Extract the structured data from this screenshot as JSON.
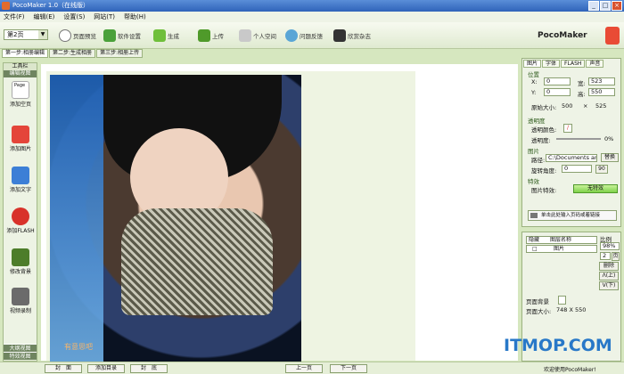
{
  "window": {
    "title": "PocoMaker 1.0（在线版）"
  },
  "menu": [
    "文件(F)",
    "编辑(E)",
    "设置(S)",
    "网站(T)",
    "帮助(H)"
  ],
  "toolbar": {
    "page_select": "第2页",
    "buttons": [
      "页面预览",
      "软件设置",
      "生成",
      "上传",
      "个人空间",
      "问题反馈",
      "欣赏杂志"
    ]
  },
  "brand": "PocoMaker",
  "tabs": [
    "第一步:相册编辑",
    "第二步:生成相册",
    "第三步:相册上传"
  ],
  "left_panel": {
    "header": "工具栏",
    "subheader": "编辑视图",
    "items": [
      "添加空页",
      "添加图片",
      "添加文字",
      "添加FLASH",
      "修改背景",
      "视频录制"
    ],
    "footer1": "大纲视图",
    "footer2": "特效视图",
    "page_label": "Page"
  },
  "right_panel": {
    "tabs": [
      "图片",
      "字体",
      "FLASH",
      "声音"
    ],
    "position_title": "位置",
    "x_label": "X:",
    "x_value": "0",
    "y_label": "Y:",
    "y_value": "0",
    "width_label": "宽:",
    "width_value": "523",
    "height_label": "高:",
    "height_value": "550",
    "original_size_label": "原始大小:",
    "orig_w": "500",
    "orig_x": "×",
    "orig_h": "525",
    "transparency_title": "透明度",
    "trans_color_label": "透明颜色:",
    "trans_level_label": "透明度:",
    "trans_level_value": "0%",
    "image_title": "图片",
    "path_label": "路径:",
    "path_value": "C:\\Documents and S",
    "replace_btn": "替换",
    "rotate_label": "旋转角度:",
    "rotate_value": "0",
    "rotate_btn": "90",
    "effect_title": "特效",
    "effect_label": "图片特效:",
    "effect_value": "无特效",
    "input_hint": "单击此处输入页码或着链接"
  },
  "layer_panel": {
    "col_hide": "隐藏",
    "col_name": "图层名称",
    "row_name": "图片",
    "ratio_label": "比例",
    "ratio_value": "98%",
    "page_no": "2",
    "page_btn": "页",
    "delete_btn": "删除",
    "up_btn": "Λ(上)",
    "down_btn": "V(下)",
    "bg_label": "页面背景",
    "size_label": "页面大小:",
    "size_value": "748 X 550"
  },
  "bottom": {
    "buttons": [
      "封　面",
      "添加目录",
      "封　底",
      "上一页",
      "下一页"
    ],
    "status": "欢迎使用PocoMaker!"
  },
  "overlay": "ITMOP.COM",
  "watermark": "有意思吧"
}
